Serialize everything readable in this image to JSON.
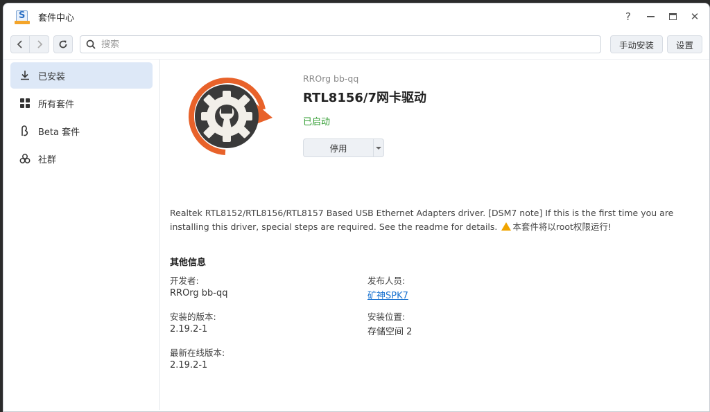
{
  "window": {
    "title": "套件中心",
    "controls": {
      "help": "?",
      "close": "✕"
    }
  },
  "toolbar": {
    "search_placeholder": "搜索",
    "manual_install": "手动安装",
    "settings": "设置"
  },
  "sidebar": {
    "items": [
      {
        "label": "已安装",
        "icon": "download-icon",
        "active": true
      },
      {
        "label": "所有套件",
        "icon": "grid-icon",
        "active": false
      },
      {
        "label": "Beta 套件",
        "icon": "beta-icon",
        "active": false
      },
      {
        "label": "社群",
        "icon": "community-icon",
        "active": false
      }
    ]
  },
  "package": {
    "publisher": "RROrg bb-qq",
    "name": "RTL8156/7网卡驱动",
    "status": "已启动",
    "status_color": "#2e9b2e",
    "action_button": "停用",
    "description": "Realtek RTL8152/RTL8156/RTL8157 Based USB Ethernet Adapters driver. [DSM7 note] If this is the first time you are installing this driver, special steps are required. See the readme for details.",
    "description_warning": "本套件将以root权限运行!"
  },
  "other_info": {
    "title": "其他信息",
    "developer_label": "开发者:",
    "developer_value": "RROrg bb-qq",
    "publisher_label": "发布人员:",
    "publisher_value": "矿神SPK7",
    "installed_version_label": "安装的版本:",
    "installed_version_value": "2.19.2-1",
    "install_location_label": "安装位置:",
    "install_location_value": "存储空间 2",
    "latest_version_label": "最新在线版本:",
    "latest_version_value": "2.19.2-1"
  },
  "colors": {
    "accent": "#1a73d1",
    "sidebar_active": "#dde8f7",
    "logo_orange": "#e8622a",
    "logo_dark": "#3a3a3a"
  }
}
